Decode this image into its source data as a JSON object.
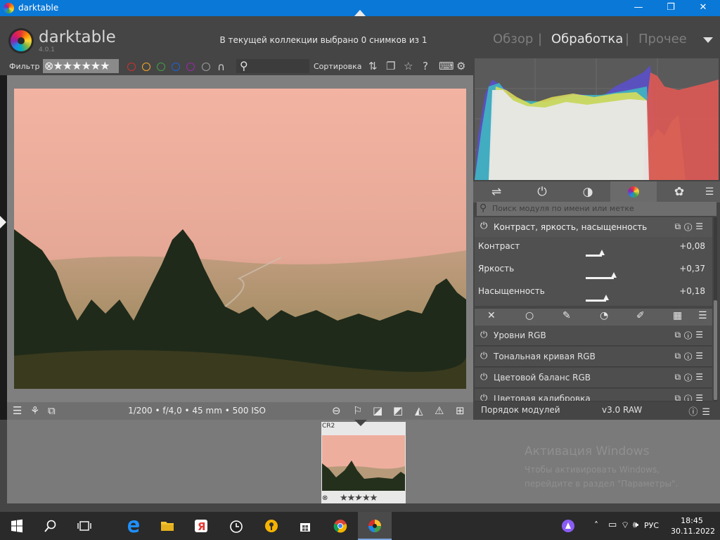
{
  "window": {
    "title": "darktable",
    "minimize": "—",
    "maximize": "❐",
    "close": "✕"
  },
  "header": {
    "brand": "darktable",
    "version": "4.0.1",
    "collection_info": "В текущей коллекции выбрано 0 снимков из 1",
    "views": [
      "Обзор",
      "Обработка",
      "Прочее"
    ],
    "active_view": "Обработка",
    "separator": "|"
  },
  "filter_bar": {
    "filter_label": "Фильтр",
    "rating_filter": "⊗★★★★★★",
    "color_labels": [
      "#d32f2f",
      "#f9a825",
      "#43a047",
      "#1e63d6",
      "#9c27b0",
      "#9e9e9e"
    ],
    "sort_label": "Сортировка"
  },
  "image_info": {
    "exif": "1/200 • f/4,0 • 45 mm • 500 ISO"
  },
  "right_panel": {
    "module_search_placeholder": "Поиск модуля по имени или метке",
    "active_module": {
      "name": "Контраст, яркость, насыщенность",
      "sliders": [
        {
          "label": "Контраст",
          "value": "+0,08",
          "fraction": 0.54
        },
        {
          "label": "Яркость",
          "value": "+0,37",
          "fraction": 0.68
        },
        {
          "label": "Насыщенность",
          "value": "+0,18",
          "fraction": 0.59
        }
      ]
    },
    "modules": [
      "Уровни RGB",
      "Тональная кривая RGB",
      "Цветовой баланс RGB",
      "Цветовая калибровка"
    ],
    "module_order_label": "Порядок модулей",
    "module_order_value": "v3.0 RAW"
  },
  "filmstrip": {
    "thumb_ext": "CR2",
    "thumb_rating": "★★★★★",
    "reject_icon": "⊗"
  },
  "activation": {
    "title": "Активация Windows",
    "line1": "Чтобы активировать Windows,",
    "line2": "перейдите в раздел \"Параметры\"."
  },
  "taskbar": {
    "language": "РУС",
    "time": "18:45",
    "date": "30.11.2022"
  }
}
